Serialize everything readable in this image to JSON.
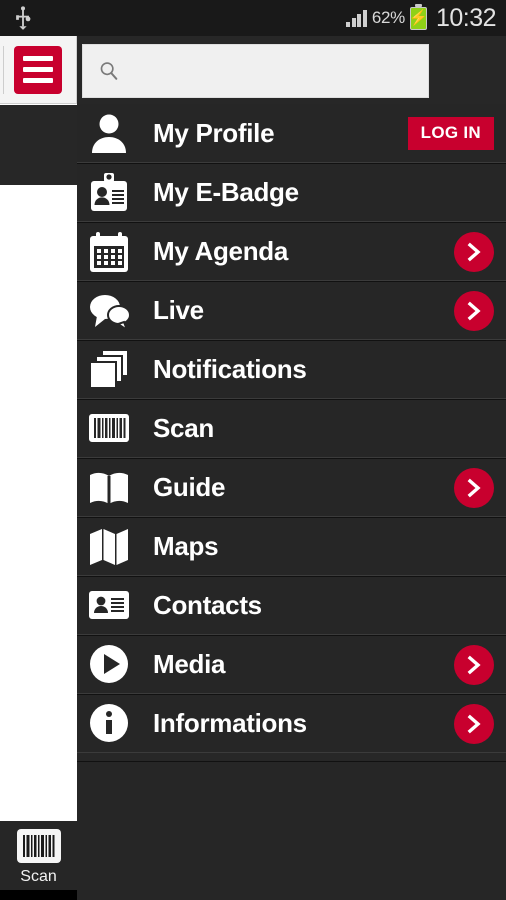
{
  "statusbar": {
    "usb_icon": "usb-icon",
    "signal_icon": "signal-bars-icon",
    "battery_percent": "62%",
    "battery_icon": "battery-charging-icon",
    "battery_color": "#8fd117",
    "clock": "10:32"
  },
  "header": {
    "menu_button_icon": "hamburger-menu-icon",
    "menu_button_color": "#c8002e"
  },
  "search": {
    "icon": "search-icon",
    "value": "",
    "placeholder": ""
  },
  "theme": {
    "accent": "#c8002e",
    "row_background": "#262626",
    "page_background": "#272727",
    "text": "#ffffff"
  },
  "menu": {
    "items": [
      {
        "label": "My Profile",
        "icon": "person-icon",
        "action": "login",
        "action_label": "LOG IN"
      },
      {
        "label": "My E-Badge",
        "icon": "id-badge-icon",
        "action": "none",
        "action_label": ""
      },
      {
        "label": "My Agenda",
        "icon": "calendar-icon",
        "action": "chevron",
        "action_label": ""
      },
      {
        "label": "Live",
        "icon": "chat-bubbles-icon",
        "action": "chevron",
        "action_label": ""
      },
      {
        "label": "Notifications",
        "icon": "stacked-cards-icon",
        "action": "none",
        "action_label": ""
      },
      {
        "label": "Scan",
        "icon": "barcode-icon",
        "action": "none",
        "action_label": ""
      },
      {
        "label": "Guide",
        "icon": "open-book-icon",
        "action": "chevron",
        "action_label": ""
      },
      {
        "label": "Maps",
        "icon": "folded-map-icon",
        "action": "none",
        "action_label": ""
      },
      {
        "label": "Contacts",
        "icon": "contact-card-icon",
        "action": "none",
        "action_label": ""
      },
      {
        "label": "Media",
        "icon": "play-circle-icon",
        "action": "chevron",
        "action_label": ""
      },
      {
        "label": "Informations",
        "icon": "info-circle-icon",
        "action": "chevron",
        "action_label": ""
      }
    ]
  },
  "shortcut": {
    "label": "Scan",
    "icon": "barcode-icon"
  }
}
